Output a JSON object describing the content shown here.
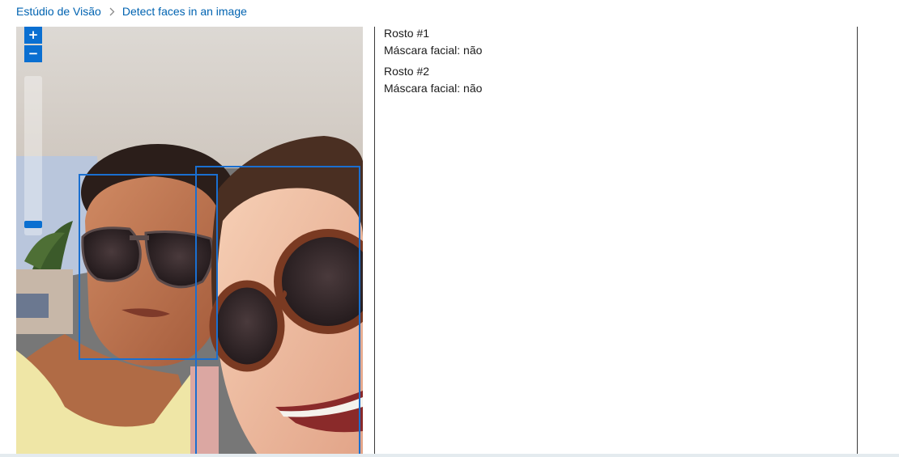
{
  "breadcrumb": {
    "root": "Estúdio de Visão",
    "current": "Detect faces in an image"
  },
  "viewer": {
    "zoom_in_label": "+",
    "zoom_out_label": "−",
    "zoom_level_fraction": 0.05,
    "face_box_color": "#1a6fd0",
    "face_count": 2
  },
  "results": {
    "faces": [
      {
        "title": "Rosto #1",
        "mask_label": "Máscara facial: não"
      },
      {
        "title": "Rosto #2",
        "mask_label": "Máscara facial: não"
      }
    ]
  },
  "colors": {
    "link": "#0063b1",
    "accent": "#0a6fd1"
  }
}
